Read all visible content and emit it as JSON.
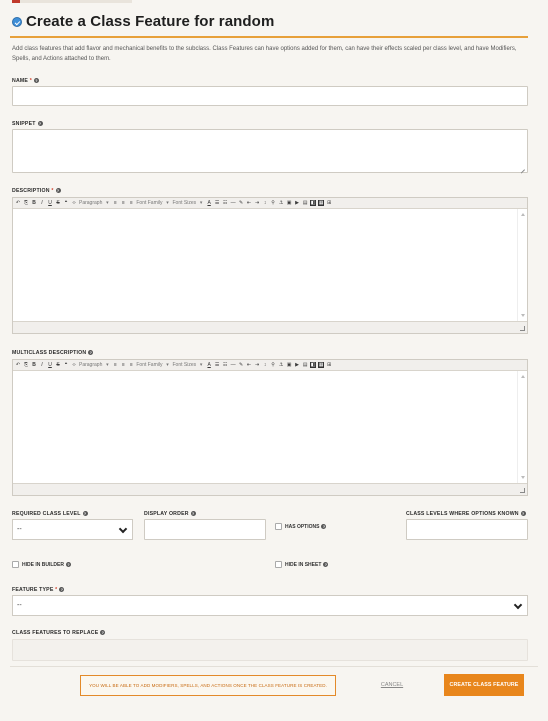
{
  "header": {
    "title": "Create a Class Feature for random",
    "intro": "Add class features that add flavor and mechanical benefits to the subclass. Class Features can have options added for them, can have their effects scaled per class level, and have Modifiers, Spells, and Actions attached to them."
  },
  "fields": {
    "name_label": "NAME",
    "snippet_label": "SNIPPET",
    "description_label": "DESCRIPTION",
    "multiclass_label": "MULTICLASS DESCRIPTION",
    "required_level_label": "REQUIRED CLASS LEVEL",
    "required_level_value": "--",
    "display_order_label": "DISPLAY ORDER",
    "has_options_label": "HAS OPTIONS",
    "levels_known_label": "CLASS LEVELS WHERE OPTIONS KNOWN",
    "hide_builder_label": "HIDE IN BUILDER",
    "hide_sheet_label": "HIDE IN SHEET",
    "feature_type_label": "FEATURE TYPE",
    "feature_type_value": "--",
    "replace_label": "CLASS FEATURES TO REPLACE",
    "required_mark": "*",
    "help_mark": "?"
  },
  "toolbar": {
    "paragraph": "Paragraph",
    "font_family": "Font Family",
    "font_sizes": "Font Sizes"
  },
  "footer": {
    "notice": "You will be able to add Modifiers, Spells, and Actions once the class feature is created.",
    "cancel": "CANCEL",
    "create": "CREATE CLASS FEATURE"
  },
  "colors": {
    "accent": "#e8861c",
    "header_rule": "#e7a03a",
    "info_icon": "#3f8fd8"
  }
}
